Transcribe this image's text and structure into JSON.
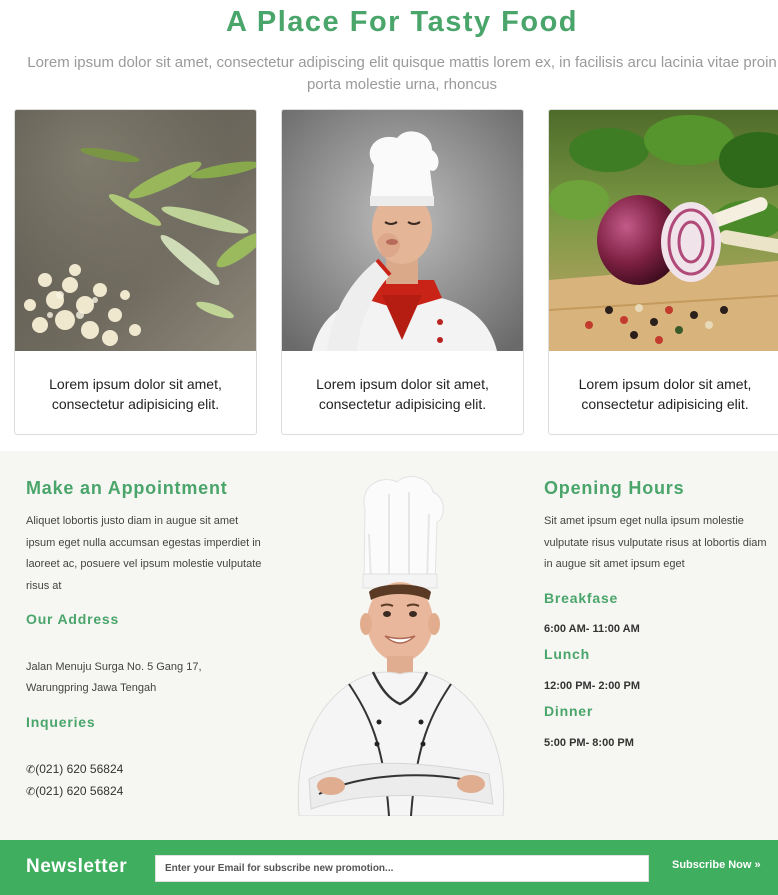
{
  "hero": {
    "title": "A Place For Tasty Food",
    "subtitle": "Lorem ipsum dolor sit amet, consectetur adipiscing elit quisque mattis lorem ex, in facilisis arcu lacinia vitae proin porta molestie urna, rhoncus"
  },
  "cards": [
    {
      "image": "chopped-green-onion-garlic",
      "caption": "Lorem ipsum dolor sit amet, consectetur adipisicing elit."
    },
    {
      "image": "chef-kissing-fingers",
      "caption": "Lorem ipsum dolor sit amet, consectetur adipisicing elit."
    },
    {
      "image": "red-onion-peppercorns-herbs",
      "caption": "Lorem ipsum dolor sit amet, consectetur adipisicing elit."
    }
  ],
  "appointment": {
    "title": "Make an Appointment",
    "text": "Aliquet lobortis justo diam in augue sit amet ipsum eget nulla accumsan egestas imperdiet in laoreet ac, posuere vel ipsum molestie vulputate risus at"
  },
  "address": {
    "title": "Our Address",
    "line1": "Jalan Menuju Surga No. 5 Gang 17,",
    "line2": "Warungpring Jawa Tengah"
  },
  "inquiries": {
    "title": "Inqueries",
    "phone1": "(021) 620 56824",
    "phone2": "(021) 620 56824",
    "phone_icon": "phone-icon"
  },
  "hours": {
    "title": "Opening Hours",
    "text": "Sit amet ipsum eget nulla ipsum molestie vulputate risus vulputate risus at lobortis diam in augue sit amet ipsum eget",
    "meals": [
      {
        "name": "Breakfase",
        "time": "6:00 AM- 11:00 AM"
      },
      {
        "name": "Lunch",
        "time": "12:00 PM- 2:00 PM"
      },
      {
        "name": "Dinner",
        "time": "5:00 PM- 8:00 PM"
      }
    ]
  },
  "newsletter": {
    "title": "Newsletter",
    "placeholder": "Enter your Email for subscribe new promotion...",
    "button": "Subscribe Now »"
  },
  "colors": {
    "accent": "#4aa56b",
    "newsletter_bar": "#3fae5f",
    "info_bg": "#f6f6f2"
  }
}
